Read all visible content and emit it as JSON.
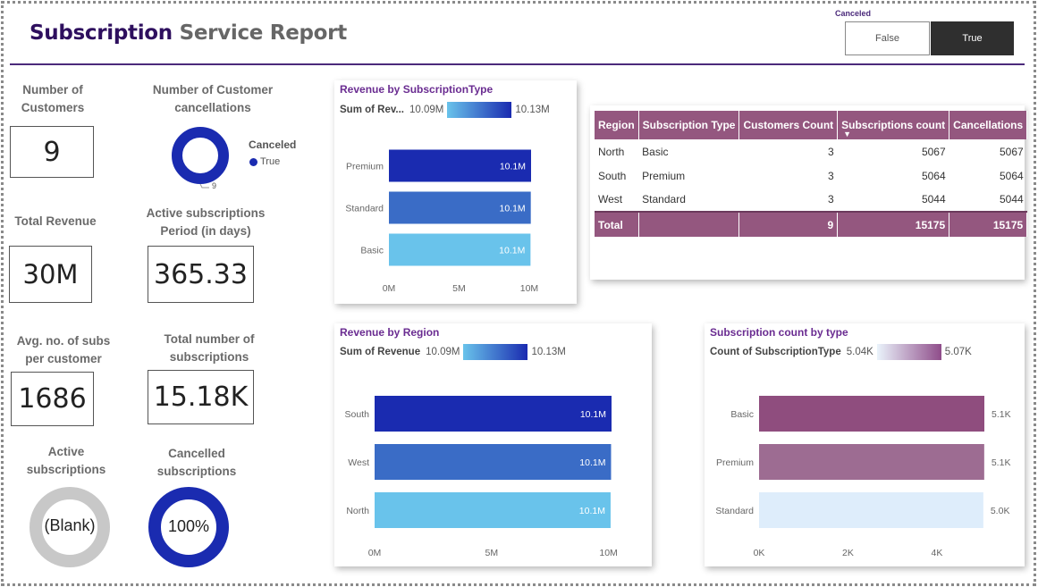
{
  "header": {
    "title_part1": "Subscription",
    "title_part2": " Service Report"
  },
  "slicer": {
    "label": "Canceled",
    "options": [
      "False",
      "True"
    ],
    "selected": "True"
  },
  "kpis": {
    "number_of_customers": {
      "label": "Number of Customers",
      "value": "9"
    },
    "total_revenue": {
      "label": "Total Revenue",
      "value": "30M"
    },
    "avg_subs": {
      "label": "Avg. no. of subs per customer",
      "value": "1686"
    },
    "active_period": {
      "label": "Active subscriptions Period (in days)",
      "value": "365.33"
    },
    "total_subscriptions": {
      "label": "Total number of subscriptions",
      "value": "15.18K"
    }
  },
  "donuts": {
    "customer_cancellations": {
      "label": "Number of Customer cancellations",
      "legend_title": "Canceled",
      "legend_item": "True",
      "legend_color": "#1a2bb0",
      "data_label": "9"
    },
    "active_subscriptions": {
      "label": "Active subscriptions",
      "center": "(Blank)",
      "color": "#c8c8c8"
    },
    "cancelled_subscriptions": {
      "label": "Cancelled subscriptions",
      "center": "100%",
      "color": "#1a2bb0"
    }
  },
  "table": {
    "columns": [
      "Region",
      "Subscription Type",
      "Customers Count",
      "Subscriptions count",
      "Cancellations"
    ],
    "rows": [
      [
        "North",
        "Basic",
        "3",
        "5067",
        "5067"
      ],
      [
        "South",
        "Premium",
        "3",
        "5064",
        "5064"
      ],
      [
        "West",
        "Standard",
        "3",
        "5044",
        "5044"
      ]
    ],
    "total": [
      "Total",
      "",
      "9",
      "15175",
      "15175"
    ]
  },
  "chart_data": [
    {
      "type": "bar",
      "title": "Revenue by SubscriptionType",
      "legend": {
        "measure": "Sum of Rev...",
        "min": "10.09M",
        "max": "10.13M"
      },
      "categories": [
        "Premium",
        "Standard",
        "Basic"
      ],
      "values": [
        10.13,
        10.11,
        10.09
      ],
      "data_labels": [
        "10.1M",
        "10.1M",
        "10.1M"
      ],
      "colors": [
        "#1a2bb0",
        "#3a6cc6",
        "#69c3eb"
      ],
      "x_ticks": [
        "0M",
        "5M",
        "10M"
      ],
      "xlim": [
        0,
        10.13
      ]
    },
    {
      "type": "bar",
      "title": "Revenue by Region",
      "legend": {
        "measure": "Sum of Revenue",
        "min": "10.09M",
        "max": "10.13M"
      },
      "categories": [
        "South",
        "West",
        "North"
      ],
      "values": [
        10.13,
        10.11,
        10.09
      ],
      "data_labels": [
        "10.1M",
        "10.1M",
        "10.1M"
      ],
      "colors": [
        "#1a2bb0",
        "#3a6cc6",
        "#69c3eb"
      ],
      "x_ticks": [
        "0M",
        "5M",
        "10M"
      ],
      "xlim": [
        0,
        10.13
      ]
    },
    {
      "type": "bar",
      "title": "Subscription count by type",
      "legend": {
        "measure": "Count of SubscriptionType",
        "min": "5.04K",
        "max": "5.07K"
      },
      "categories": [
        "Basic",
        "Premium",
        "Standard"
      ],
      "values": [
        5067,
        5064,
        5044
      ],
      "data_labels": [
        "5.1K",
        "5.1K",
        "5.0K"
      ],
      "colors": [
        "#8f4d7e",
        "#9d6c92",
        "#deedfb"
      ],
      "x_ticks": [
        "0K",
        "2K",
        "4K"
      ],
      "xlim": [
        0,
        5067
      ]
    }
  ]
}
